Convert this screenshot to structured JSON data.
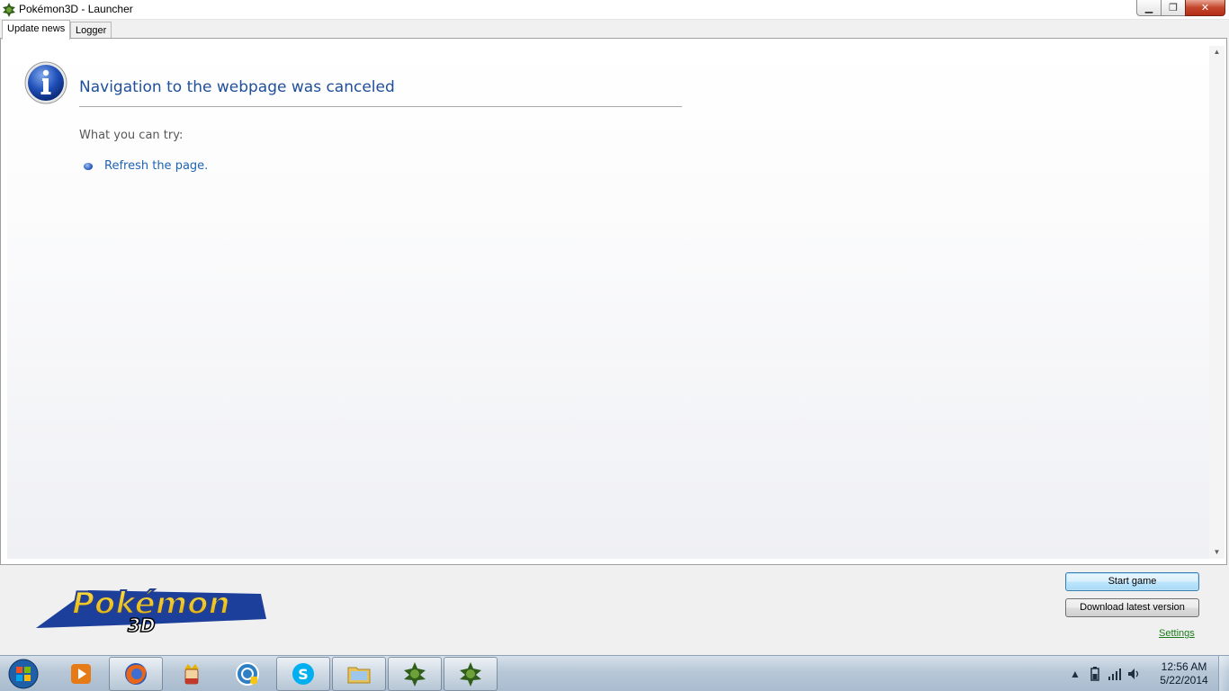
{
  "window": {
    "title": "Pokémon3D - Launcher",
    "minimize_glyph": "▁",
    "maximize_glyph": "❐",
    "close_glyph": "✕"
  },
  "tabs": [
    {
      "label": "Update news",
      "active": true
    },
    {
      "label": "Logger",
      "active": false
    }
  ],
  "error_page": {
    "icon": "info-icon",
    "heading": "Navigation to the webpage was canceled",
    "try_label": "What you can try:",
    "refresh_link": "Refresh the page."
  },
  "scrollbar": {
    "up": "▲",
    "down": "▼"
  },
  "logo": {
    "text": "Pokémon",
    "sub": "3D"
  },
  "actions": {
    "start_game": "Start game",
    "download_latest": "Download latest version",
    "settings": "Settings"
  },
  "taskbar": {
    "apps": [
      "windows-media-player-icon",
      "firefox-icon",
      "game-king-icon",
      "network-shield-icon",
      "skype-icon",
      "file-explorer-icon",
      "pokemon3d-icon",
      "pokemon3d-icon"
    ],
    "tray_overflow": "▲",
    "clock_time": "12:56 AM",
    "clock_date": "5/22/2014"
  },
  "colors": {
    "heading": "#1f4f9a",
    "link": "#1e63b3",
    "settings_link": "#1a7a1a"
  }
}
